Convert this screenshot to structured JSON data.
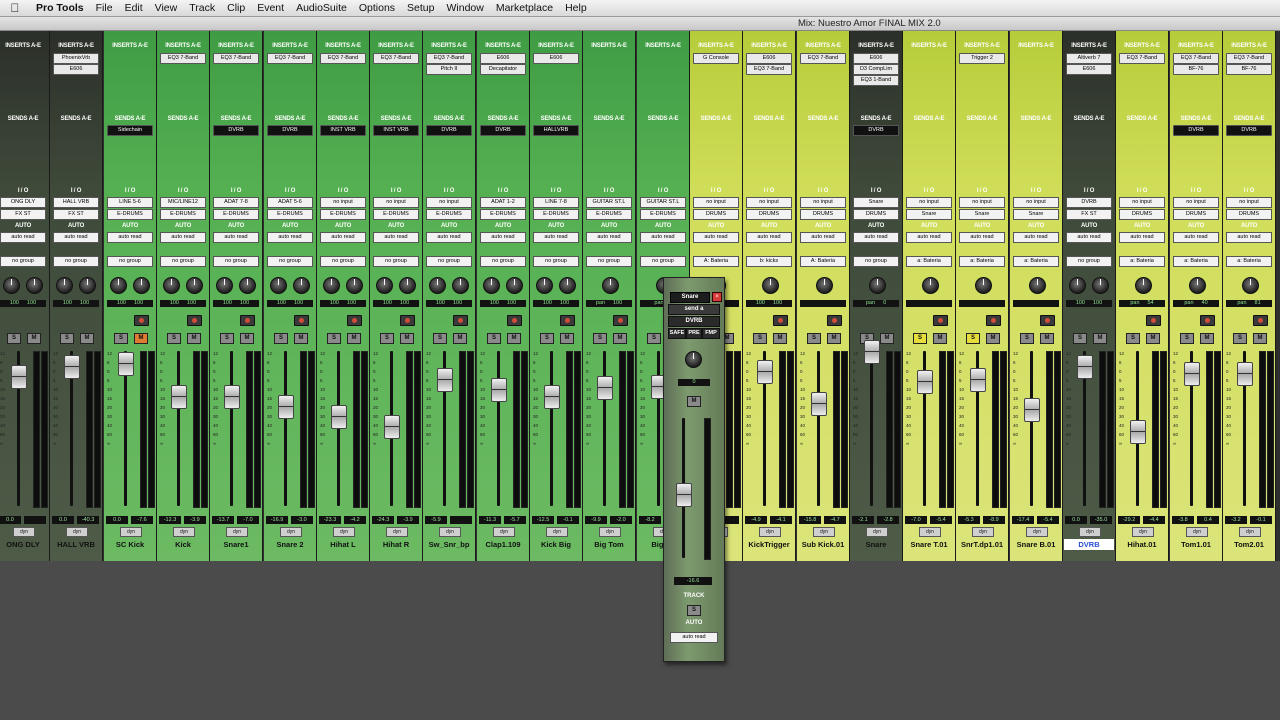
{
  "menu": {
    "apple": "",
    "app": "Pro Tools",
    "items": [
      "File",
      "Edit",
      "View",
      "Track",
      "Clip",
      "Event",
      "AudioSuite",
      "Options",
      "Setup",
      "Window",
      "Marketplace",
      "Help"
    ]
  },
  "window": {
    "title": "Mix: Nuestro Amor FINAL MIX 2.0"
  },
  "labels": {
    "inserts": "INSERTS A-E",
    "sends": "SENDS A-E",
    "io": "I / O",
    "auto": "AUTO",
    "dyn": "dyn",
    "solo": "S",
    "mute": "M"
  },
  "colors": {
    "green": "#49a84a",
    "lightgreen": "#7ec56e",
    "yellow": "#d6e05c",
    "dark": "#2f332c"
  },
  "strips": [
    {
      "name": "ONG DLY",
      "color": "dark",
      "inserts": [],
      "sends": [],
      "io_in": "ONG DLY",
      "io_out": "FX ST",
      "auto": "auto read",
      "group": "no group",
      "pan_l": "100",
      "pan_r": "100",
      "vol": "0.0",
      "peak": "",
      "solo_on": false,
      "mute_on": false,
      "rec": false
    },
    {
      "name": "HALL VRB",
      "color": "dark",
      "inserts": [
        "PhoenixVrb",
        "E606"
      ],
      "sends": [],
      "io_in": "HALL VRB",
      "io_out": "FX ST",
      "auto": "auto read",
      "group": "no group",
      "pan_l": "100",
      "pan_r": "100",
      "vol": "0.0",
      "peak": "-40.3",
      "solo_on": false,
      "mute_on": false,
      "rec": false
    },
    {
      "name": "SC Kick",
      "color": "green",
      "inserts": [],
      "sends": [
        "Sidechain"
      ],
      "io_in": "LINE 5-6",
      "io_out": "E-DRUMS",
      "auto": "auto read",
      "group": "no group",
      "pan_l": "100",
      "pan_r": "100",
      "vol": "0.0",
      "peak": "-7.6",
      "solo_on": false,
      "mute_on": true,
      "rec": true
    },
    {
      "name": "Kick",
      "color": "green",
      "inserts": [
        "EQ3 7-Band"
      ],
      "sends": [],
      "io_in": "MIC/LINE12",
      "io_out": "E-DRUMS",
      "auto": "auto read",
      "group": "no group",
      "pan_l": "100",
      "pan_r": "100",
      "vol": "-12.3",
      "peak": "-3.9",
      "solo_on": false,
      "mute_on": false,
      "rec": true
    },
    {
      "name": "Snare1",
      "color": "green",
      "inserts": [
        "EQ3 7-Band"
      ],
      "sends": [
        "DVRB"
      ],
      "io_in": "ADAT 7-8",
      "io_out": "E-DRUMS",
      "auto": "auto read",
      "group": "no group",
      "pan_l": "100",
      "pan_r": "100",
      "vol": "-13.7",
      "peak": "-7.0",
      "solo_on": false,
      "mute_on": false,
      "rec": true
    },
    {
      "name": "Snare 2",
      "color": "green",
      "inserts": [
        "EQ3 7-Band"
      ],
      "sends": [
        "DVRB"
      ],
      "io_in": "ADAT 5-6",
      "io_out": "E-DRUMS",
      "auto": "auto read",
      "group": "no group",
      "pan_l": "100",
      "pan_r": "100",
      "vol": "-16.9",
      "peak": "-3.0",
      "solo_on": false,
      "mute_on": false,
      "rec": true
    },
    {
      "name": "Hihat L",
      "color": "green",
      "inserts": [
        "EQ3 7-Band"
      ],
      "sends": [
        "INST VRB"
      ],
      "io_in": "no input",
      "io_out": "E-DRUMS",
      "auto": "auto read",
      "group": "no group",
      "pan_l": "100",
      "pan_r": "100",
      "vol": "-23.3",
      "peak": "-4.2",
      "solo_on": false,
      "mute_on": false,
      "rec": true
    },
    {
      "name": "Hihat R",
      "color": "green",
      "inserts": [
        "EQ3 7-Band"
      ],
      "sends": [
        "INST VRB"
      ],
      "io_in": "no input",
      "io_out": "E-DRUMS",
      "auto": "auto read",
      "group": "no group",
      "pan_l": "100",
      "pan_r": "100",
      "vol": "-24.3",
      "peak": "-3.9",
      "solo_on": false,
      "mute_on": false,
      "rec": true
    },
    {
      "name": "Sw_Snr_bp",
      "color": "green",
      "inserts": [
        "EQ3 7-Band",
        "Pitch II"
      ],
      "sends": [
        "DVRB"
      ],
      "io_in": "no input",
      "io_out": "E-DRUMS",
      "auto": "auto read",
      "group": "no group",
      "pan_l": "100",
      "pan_r": "100",
      "vol": "-5.9",
      "peak": "",
      "solo_on": false,
      "mute_on": false,
      "rec": true
    },
    {
      "name": "Clap1.109",
      "color": "green",
      "inserts": [
        "E606",
        "Decapitator"
      ],
      "sends": [
        "DVRB"
      ],
      "io_in": "ADAT 1-2",
      "io_out": "E-DRUMS",
      "auto": "auto read",
      "group": "no group",
      "pan_l": "100",
      "pan_r": "100",
      "vol": "-11.3",
      "peak": "-5.7",
      "solo_on": false,
      "mute_on": false,
      "rec": true
    },
    {
      "name": "Kick Big",
      "color": "green",
      "inserts": [
        "E606"
      ],
      "sends": [
        "HALLVRB"
      ],
      "io_in": "LINE 7-8",
      "io_out": "E-DRUMS",
      "auto": "auto read",
      "group": "no group",
      "pan_l": "100",
      "pan_r": "100",
      "vol": "-12.5",
      "peak": "-0.1",
      "solo_on": false,
      "mute_on": false,
      "rec": true
    },
    {
      "name": "Big Tom",
      "color": "green",
      "inserts": [],
      "sends": [],
      "io_in": "GUITAR ST.L",
      "io_out": "E-DRUMS",
      "auto": "auto read",
      "group": "no group",
      "pan_l": "pan",
      "pan_r": "100",
      "vol": "-9.9",
      "peak": "-2.0",
      "solo_on": false,
      "mute_on": false,
      "rec": true
    },
    {
      "name": "BigTm",
      "color": "green",
      "inserts": [],
      "sends": [],
      "io_in": "GUITAR ST.L",
      "io_out": "E-DRUMS",
      "auto": "auto read",
      "group": "no group",
      "pan_l": "pan",
      "pan_r": "",
      "vol": "-8.2",
      "peak": "",
      "solo_on": false,
      "mute_on": false,
      "rec": true
    },
    {
      "name": "",
      "color": "yellow",
      "inserts": [
        "G Console"
      ],
      "sends": [],
      "io_in": "no input",
      "io_out": "DRUMS",
      "auto": "auto read",
      "group": "A: Bateria",
      "pan_l": "",
      "pan_r": "",
      "vol": "",
      "peak": "",
      "solo_on": false,
      "mute_on": false,
      "rec": false
    },
    {
      "name": "KickTrigger",
      "color": "yellow",
      "inserts": [
        "E606",
        "EQ3 7-Band"
      ],
      "sends": [],
      "io_in": "no input",
      "io_out": "DRUMS",
      "auto": "auto read",
      "group": "b: kicks",
      "pan_l": "100",
      "pan_r": "100",
      "vol": "-4.9",
      "peak": "-4.1",
      "solo_on": false,
      "mute_on": false,
      "rec": true
    },
    {
      "name": "Sub Kick.01",
      "color": "yellow",
      "inserts": [
        "EQ3 7-Band"
      ],
      "sends": [],
      "io_in": "no input",
      "io_out": "DRUMS",
      "auto": "auto read",
      "group": "A: Bateria",
      "pan_l": "",
      "pan_r": "",
      "vol": "-15.8",
      "peak": "-4.7",
      "solo_on": false,
      "mute_on": false,
      "rec": true
    },
    {
      "name": "Snare",
      "color": "dark",
      "inserts": [
        "E606",
        "D3 CompLim",
        "EQ3 1-Band"
      ],
      "sends": [
        "DVRB"
      ],
      "io_in": "Snare",
      "io_out": "DRUMS",
      "auto": "auto read",
      "group": "no group",
      "pan_l": "pan",
      "pan_r": "0",
      "vol": "-2.1",
      "peak": "-2.8",
      "solo_on": false,
      "mute_on": false,
      "rec": false
    },
    {
      "name": "Snare T.01",
      "color": "yellow",
      "inserts": [],
      "sends": [],
      "io_in": "no input",
      "io_out": "Snare",
      "auto": "auto read",
      "group": "a: Bateria",
      "pan_l": "",
      "pan_r": "",
      "vol": "-7.0",
      "peak": "-5.4",
      "solo_on": true,
      "mute_on": false,
      "rec": true
    },
    {
      "name": "SnrT.dp1.01",
      "color": "yellow",
      "inserts": [
        "Trigger 2"
      ],
      "sends": [],
      "io_in": "no input",
      "io_out": "Snare",
      "auto": "auto read",
      "group": "a: Bateria",
      "pan_l": "",
      "pan_r": "",
      "vol": "-5.3",
      "peak": "-8.9",
      "solo_on": true,
      "mute_on": false,
      "rec": true
    },
    {
      "name": "Snare B.01",
      "color": "yellow",
      "inserts": [],
      "sends": [],
      "io_in": "no input",
      "io_out": "Snare",
      "auto": "auto read",
      "group": "a: Bateria",
      "pan_l": "",
      "pan_r": "",
      "vol": "-17.4",
      "peak": "-5.4",
      "solo_on": false,
      "mute_on": false,
      "rec": true
    },
    {
      "name": "DVRB",
      "color": "dark",
      "inserts": [
        "Altiverb 7",
        "E606"
      ],
      "sends": [],
      "io_in": "DVRB",
      "io_out": "FX ST",
      "auto": "auto read",
      "group": "no group",
      "pan_l": "100",
      "pan_r": "100",
      "vol": "0.0",
      "peak": "-35.0",
      "solo_on": false,
      "mute_on": false,
      "rec": false,
      "selected": true
    },
    {
      "name": "Hihat.01",
      "color": "yellow",
      "inserts": [
        "EQ3 7-Band"
      ],
      "sends": [],
      "io_in": "no input",
      "io_out": "DRUMS",
      "auto": "auto read",
      "group": "a: Bateria",
      "pan_l": "pan",
      "pan_r": "54",
      "vol": "-29.2",
      "peak": "-4.4",
      "solo_on": false,
      "mute_on": false,
      "rec": true
    },
    {
      "name": "Tom1.01",
      "color": "yellow",
      "inserts": [
        "EQ3 7-Band",
        "BF-76"
      ],
      "sends": [
        "DVRB"
      ],
      "io_in": "no input",
      "io_out": "DRUMS",
      "auto": "auto read",
      "group": "a: Bateria",
      "pan_l": "pan",
      "pan_r": "40",
      "vol": "-3.8",
      "peak": "0.4",
      "solo_on": false,
      "mute_on": false,
      "rec": true
    },
    {
      "name": "Tom2.01",
      "color": "yellow",
      "inserts": [
        "EQ3 7-Band",
        "BF-76"
      ],
      "sends": [
        "DVRB"
      ],
      "io_in": "no input",
      "io_out": "DRUMS",
      "auto": "auto read",
      "group": "a: Bateria",
      "pan_l": "pan",
      "pan_r": "81",
      "vol": "-3.2",
      "peak": "-0.1",
      "solo_on": false,
      "mute_on": false,
      "rec": true
    }
  ],
  "send_window": {
    "track": "Snare",
    "send": "send a",
    "target": "DVRB",
    "safe": "SAFE",
    "pre": "PRE",
    "fmp": "FMP",
    "pan": "0",
    "mute": "M",
    "level": "-16.6",
    "track_label": "TRACK",
    "solo": "S",
    "auto_label": "AUTO",
    "auto_mode": "auto read"
  },
  "scale_marks": [
    "12",
    "6",
    "0",
    "5",
    "10",
    "15",
    "20",
    "30",
    "40",
    "60",
    "∞"
  ]
}
